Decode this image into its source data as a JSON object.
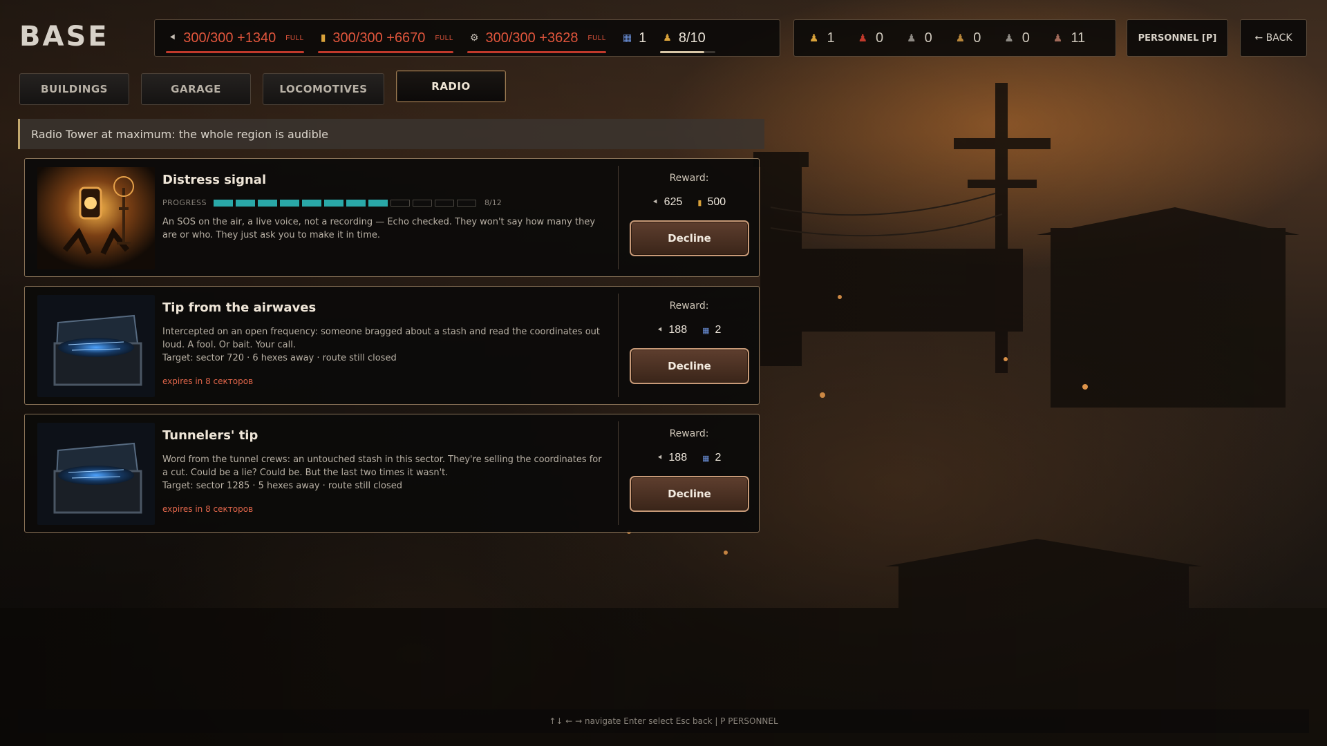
{
  "title": "BASE",
  "resources": [
    {
      "icon": "scrap-icon",
      "glyph": "⯇",
      "value": "300/300 +1340",
      "badge": "FULL"
    },
    {
      "icon": "fuel-icon",
      "glyph": "▮",
      "value": "300/300 +6670",
      "badge": "FULL"
    },
    {
      "icon": "gear-parts-icon",
      "glyph": "⚙",
      "value": "300/300 +3628",
      "badge": "FULL"
    },
    {
      "icon": "map-icon",
      "glyph": "▦",
      "value": "1"
    },
    {
      "icon": "population-icon",
      "glyph": "♟",
      "value": "8/10",
      "fill_fraction": 0.8
    }
  ],
  "crew": [
    {
      "icon": "worker-icon",
      "value": "1",
      "color": "#d9a23a"
    },
    {
      "icon": "soldier-icon",
      "value": "0",
      "color": "#c0392b"
    },
    {
      "icon": "engineer-icon",
      "value": "0",
      "color": "#8e8a84"
    },
    {
      "icon": "scout-icon",
      "value": "0",
      "color": "#b8863a"
    },
    {
      "icon": "medic-icon",
      "value": "0",
      "color": "#8e8a84"
    },
    {
      "icon": "civilian-icon",
      "value": "11",
      "color": "#a26a5a"
    }
  ],
  "buttons": {
    "personnel": "PERSONNEL [P]",
    "back": "← BACK"
  },
  "tabs": [
    {
      "label": "BUILDINGS"
    },
    {
      "label": "GARAGE"
    },
    {
      "label": "LOCOMOTIVES"
    },
    {
      "label": "RADIO",
      "active": true
    }
  ],
  "banner": "Radio Tower at maximum: the whole region is audible",
  "missions": [
    {
      "title": "Distress signal",
      "progress_label": "PROGRESS",
      "progress_value": 8,
      "progress_max": 12,
      "progress_text": "8/12",
      "description": "An SOS on the air, a live voice, not a recording — Echo checked. They won't say how many they are or who. They just ask you to make it in time.",
      "reward_label": "Reward:",
      "rewards": [
        {
          "icon": "scrap-icon",
          "value": "625"
        },
        {
          "icon": "fuel-icon",
          "value": "500"
        }
      ],
      "button": "Decline"
    },
    {
      "title": "Tip from the airwaves",
      "description": "Intercepted on an open frequency: someone bragged about a stash and read the coordinates out loud. A fool. Or bait. Your call.",
      "target": "Target: sector 720 · 6 hexes away · route still closed",
      "expires": "expires in 8 секторов",
      "reward_label": "Reward:",
      "rewards": [
        {
          "icon": "scrap-icon",
          "value": "188"
        },
        {
          "icon": "map-icon",
          "value": "2"
        }
      ],
      "button": "Decline"
    },
    {
      "title": "Tunnelers' tip",
      "description": "Word from the tunnel crews: an untouched stash in this sector. They're selling the coordinates for a cut. Could be a lie? Could be. But the last two times it wasn't.",
      "target": "Target: sector 1285 · 5 hexes away · route still closed",
      "expires": "expires in 8 секторов",
      "reward_label": "Reward:",
      "rewards": [
        {
          "icon": "scrap-icon",
          "value": "188"
        },
        {
          "icon": "map-icon",
          "value": "2"
        }
      ],
      "button": "Decline"
    }
  ],
  "footer": "↑↓ ← → navigate Enter select Esc back | P PERSONNEL",
  "colors": {
    "accent_red": "#e0553c",
    "progress_teal": "#2aa8a8",
    "decline_button": "#4a3022"
  }
}
